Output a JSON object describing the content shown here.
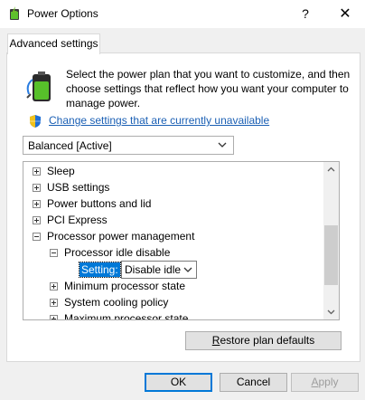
{
  "window": {
    "title": "Power Options",
    "help_glyph": "?",
    "close_glyph": "✕"
  },
  "tab": {
    "label": "Advanced settings"
  },
  "description": "Select the power plan that you want to customize, and then choose settings that reflect how you want your computer to manage power.",
  "change_link": "Change settings that are currently unavailable",
  "plan_select": {
    "value": "Balanced [Active]"
  },
  "tree": {
    "items": [
      {
        "label": "Sleep"
      },
      {
        "label": "USB settings"
      },
      {
        "label": "Power buttons and lid"
      },
      {
        "label": "PCI Express"
      },
      {
        "label": "Processor power management"
      },
      {
        "label": "Processor idle disable"
      },
      {
        "label": "Minimum processor state"
      },
      {
        "label": "System cooling policy"
      },
      {
        "label": "Maximum processor state"
      }
    ],
    "setting_label": "Setting:",
    "setting_value": "Disable idle"
  },
  "buttons": {
    "restore_r": "R",
    "restore_rest": "estore plan defaults",
    "ok": "OK",
    "cancel": "Cancel",
    "apply_a": "A",
    "apply_rest": "pply"
  },
  "colors": {
    "accent": "#0078d7",
    "link": "#1a5fb4"
  }
}
